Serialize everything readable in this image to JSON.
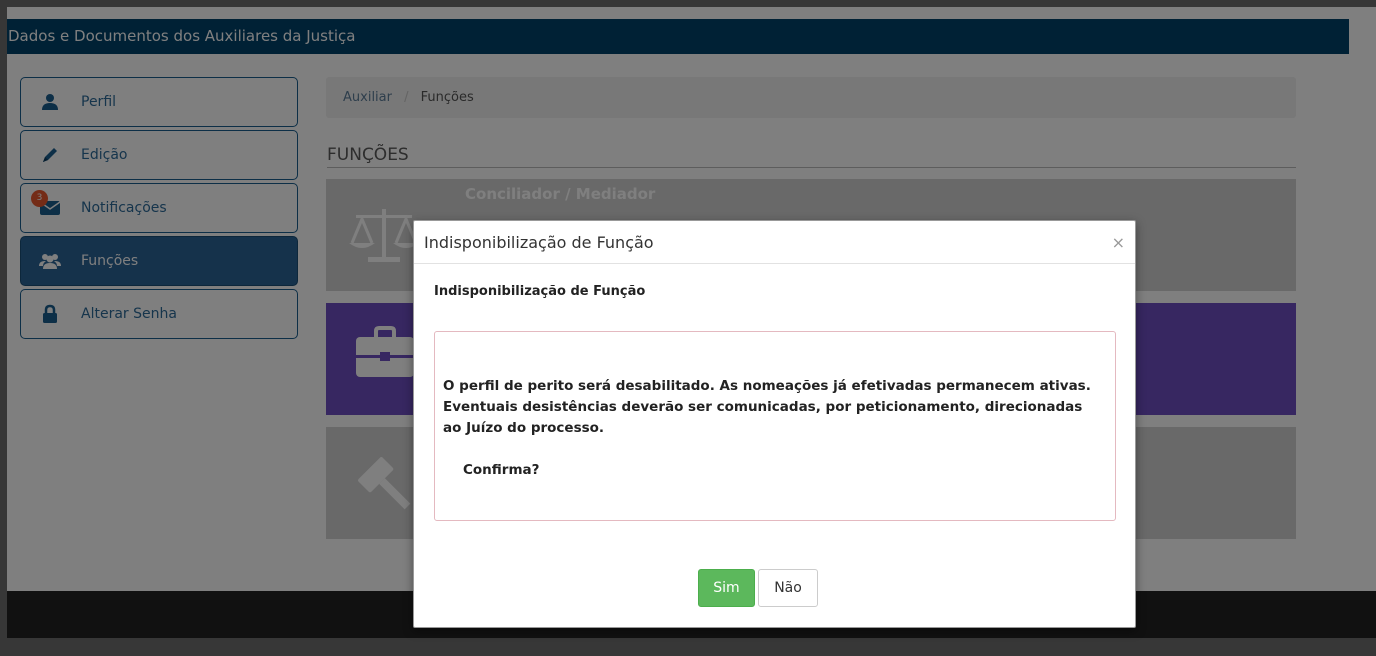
{
  "header": {
    "title": "Dados e Documentos dos Auxiliares da Justiça"
  },
  "sidebar": {
    "items": [
      {
        "label": "Perfil",
        "icon": "user-icon"
      },
      {
        "label": "Edição",
        "icon": "pencil-icon"
      },
      {
        "label": "Notificações",
        "icon": "envelope-icon",
        "badge": "3"
      },
      {
        "label": "Funções",
        "icon": "users-icon",
        "active": true
      },
      {
        "label": "Alterar Senha",
        "icon": "lock-icon"
      }
    ]
  },
  "breadcrumb": {
    "parent": "Auxiliar",
    "separator": "/",
    "current": "Funções"
  },
  "section": {
    "title": "FUNÇÕES"
  },
  "cards": [
    {
      "title": "Conciliador / Mediador",
      "icon": "scales-icon",
      "color": "#d3d3d3"
    },
    {
      "title": "",
      "icon": "briefcase-icon",
      "color": "#6e4ec2"
    },
    {
      "title": "",
      "icon": "gavel-icon",
      "color": "#d3d3d3"
    }
  ],
  "modal": {
    "title": "Indisponibilização de Função",
    "close": "×",
    "subtitle": "Indisponibilização de Função",
    "message_line1": "O perfil de perito será desabilitado. As nomeações já efetivadas permanecem ativas.",
    "message_line2": "Eventuais desistências deverão ser comunicadas, por peticionamento, direcionadas",
    "message_line3": "ao Juízo do processo.",
    "confirm": "Confirma?",
    "yes_label": "Sim",
    "no_label": "Não"
  },
  "colors": {
    "accent": "#00426b",
    "success": "#5cb85c",
    "active": "#2a6496"
  }
}
